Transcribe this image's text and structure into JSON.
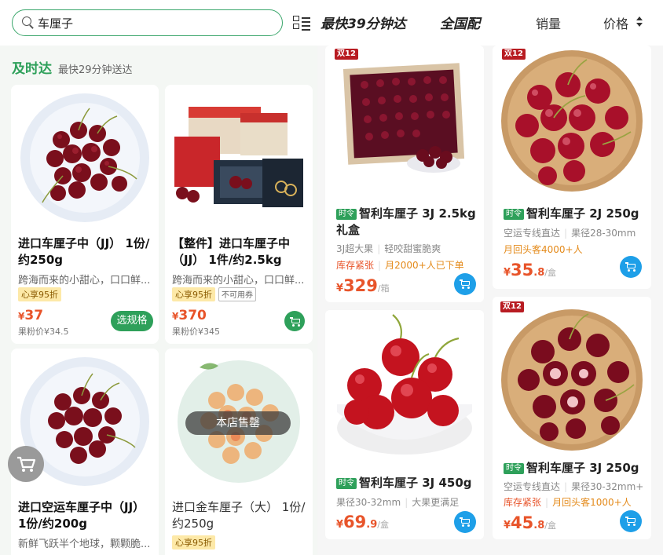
{
  "search": {
    "query": "车厘子"
  },
  "header_tabs": {
    "fast": "最快39分钟达",
    "national": "全国配",
    "sales": "销量",
    "price": "价格"
  },
  "section": {
    "title": "及时达",
    "subtitle": "最快29分钟送达"
  },
  "left_products": [
    {
      "name": "进口车厘子中（JJ） 1份/约250g",
      "desc": "跨海而来的小甜心，口口鲜...",
      "discount": "心享95折",
      "extra_tag": "",
      "price": "37",
      "member_price": "果粉价¥34.5",
      "action": "选规格",
      "soldout": ""
    },
    {
      "name": "【整件】进口车厘子中（JJ） 1件/约2.5kg",
      "desc": "跨海而来的小甜心，口口鲜...",
      "discount": "心享95折",
      "extra_tag": "不可用券",
      "price": "370",
      "member_price": "果粉价¥345",
      "action": "",
      "soldout": ""
    },
    {
      "name": "进口空运车厘子中（JJ） 1份/约200g",
      "desc": "新鲜飞跃半个地球，颗颗脆...",
      "discount": "",
      "extra_tag": "",
      "price": "",
      "member_price": "",
      "action": "",
      "soldout": ""
    },
    {
      "name": "进口金车厘子（大） 1份/约250g",
      "desc": "",
      "discount": "心享95折",
      "extra_tag": "",
      "price": "",
      "member_price": "",
      "action": "",
      "soldout": "本店售罄"
    }
  ],
  "right_products": [
    {
      "badge": "双12",
      "time_tag": "时令",
      "name": "智利车厘子 3J 2.5kg 礼盒",
      "line1": [
        "3J超大果",
        "轻咬甜蜜脆爽"
      ],
      "line2": [
        "库存紧张",
        "月2000+人已下单"
      ],
      "price_int": "329",
      "price_dec": "",
      "unit": "/箱"
    },
    {
      "badge": "双12",
      "time_tag": "时令",
      "name": "智利车厘子 2J 250g",
      "line1": [
        "空运专线直达",
        "果径28-30mm"
      ],
      "line2": [
        "",
        "月回头客4000+人"
      ],
      "price_int": "35",
      "price_dec": ".8",
      "unit": "/盒"
    },
    {
      "badge": "",
      "time_tag": "时令",
      "name": "智利车厘子 3J 450g",
      "line1": [
        "果径30-32mm",
        "大果更满足"
      ],
      "line2": [
        "",
        ""
      ],
      "price_int": "69",
      "price_dec": ".9",
      "unit": "/盒"
    },
    {
      "badge": "双12",
      "time_tag": "时令",
      "name": "智利车厘子 3J 250g",
      "line1": [
        "空运专线直达",
        "果径30-32mm+"
      ],
      "line2": [
        "库存紧张",
        "月回头客1000+人"
      ],
      "price_int": "45",
      "price_dec": ".8",
      "unit": "/盒"
    }
  ],
  "currency": "¥",
  "colors": {
    "accent_green": "#2ea05a",
    "price_red": "#e8542a",
    "cart_blue": "#1e9fe8",
    "badge_red": "#b81c22"
  }
}
